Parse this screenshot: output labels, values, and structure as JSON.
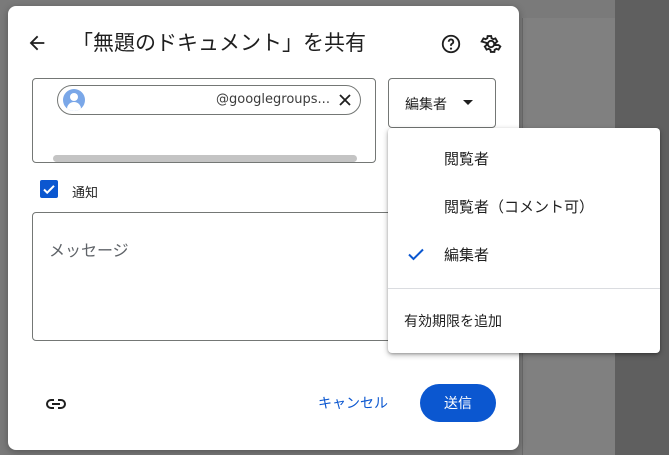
{
  "dialog": {
    "title": "「無題のドキュメント」を共有",
    "icons": {
      "back": "arrow-back-icon",
      "help": "help-icon",
      "settings": "gear-icon",
      "link": "link-icon"
    }
  },
  "people": {
    "chip_text": "@googlegroups...",
    "chip_avatar": "person-avatar-icon"
  },
  "role": {
    "selected": "編集者"
  },
  "notify": {
    "label": "通知",
    "checked": true
  },
  "message": {
    "placeholder": "メッセージ"
  },
  "actions": {
    "cancel": "キャンセル",
    "send": "送信"
  },
  "role_menu": {
    "items": [
      {
        "label": "閲覧者",
        "selected": false
      },
      {
        "label": "閲覧者（コメント可）",
        "selected": false
      },
      {
        "label": "編集者",
        "selected": true
      }
    ],
    "expiry_label": "有効期限を追加"
  },
  "colors": {
    "accent": "#0b57d0",
    "overlay": "#5f5f5f"
  }
}
